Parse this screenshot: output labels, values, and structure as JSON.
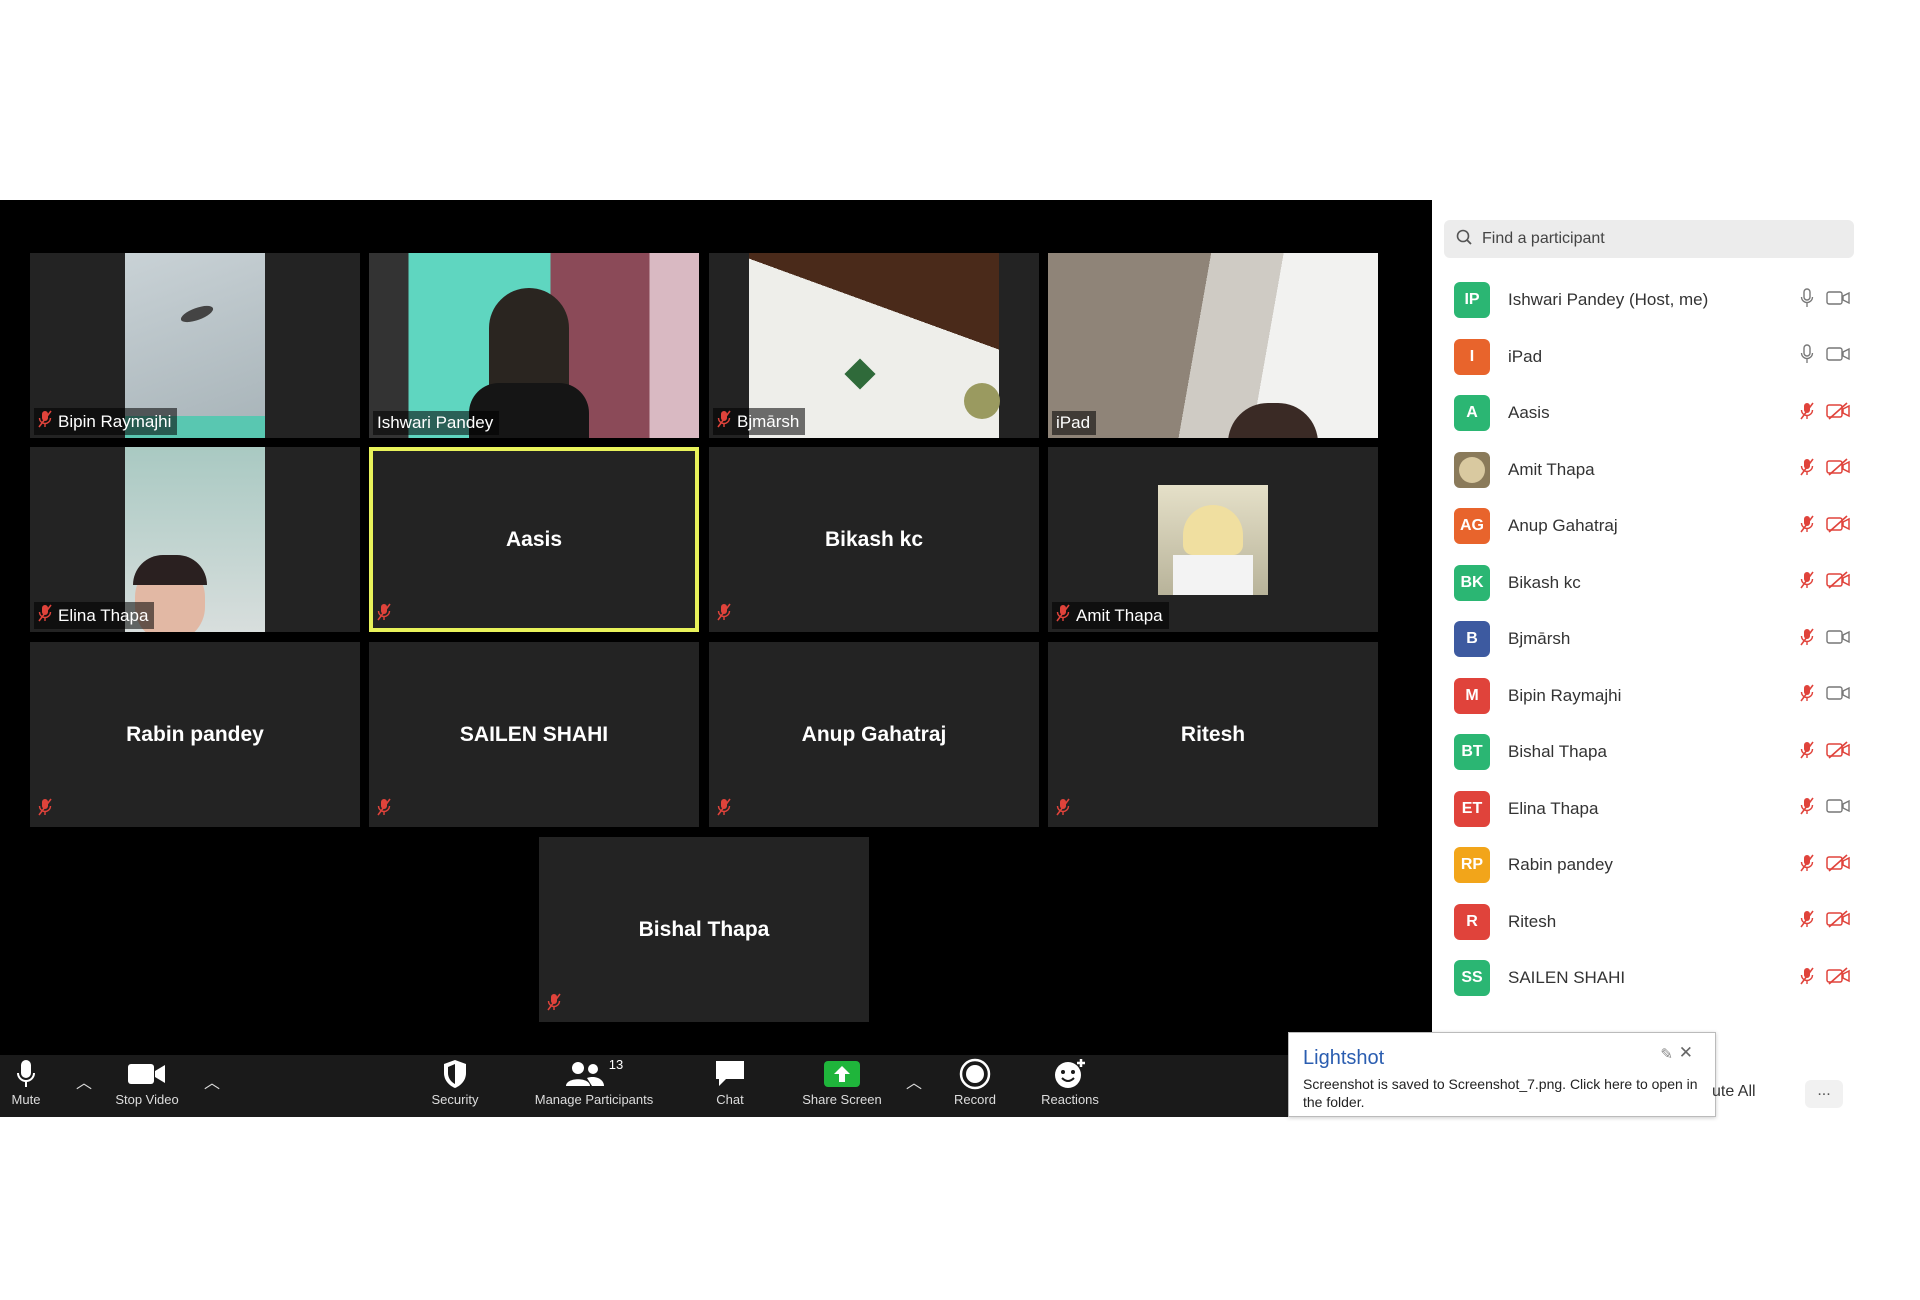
{
  "colors": {
    "active_border": "#e8f25a",
    "muted_red": "#e0433b",
    "share_green": "#1fb53b"
  },
  "video_grid": [
    {
      "name": "Bipin Raymajhi",
      "has_video": true,
      "muted": true
    },
    {
      "name": "Ishwari Pandey",
      "has_video": true,
      "muted": false
    },
    {
      "name": "Bjmārsh",
      "has_video": true,
      "muted": true
    },
    {
      "name": "iPad",
      "has_video": true,
      "muted": false
    },
    {
      "name": "Elina Thapa",
      "has_video": true,
      "muted": true
    },
    {
      "name": "Aasis",
      "has_video": false,
      "muted": true,
      "active_speaker": true
    },
    {
      "name": "Bikash kc",
      "has_video": false,
      "muted": true
    },
    {
      "name": "Amit Thapa",
      "has_video": false,
      "has_profile_picture": true,
      "muted": true
    },
    {
      "name": "Rabin pandey",
      "has_video": false,
      "muted": true
    },
    {
      "name": "SAILEN SHAHI",
      "has_video": false,
      "muted": true
    },
    {
      "name": "Anup Gahatraj",
      "has_video": false,
      "muted": true
    },
    {
      "name": "Ritesh",
      "has_video": false,
      "muted": true
    },
    {
      "name": "Bishal Thapa",
      "has_video": false,
      "muted": true
    }
  ],
  "toolbar": {
    "mute": "Mute",
    "stop_video": "Stop Video",
    "security": "Security",
    "manage_participants": "Manage Participants",
    "participant_count": "13",
    "chat": "Chat",
    "share_screen": "Share Screen",
    "record": "Record",
    "reactions": "Reactions"
  },
  "participants_panel": {
    "search_placeholder": "Find a participant",
    "participants": [
      {
        "initials": "IP",
        "name": "Ishwari Pandey (Host, me)",
        "avatar_color": "#2bb673",
        "mic": "on",
        "video": "on"
      },
      {
        "initials": "I",
        "name": "iPad",
        "avatar_color": "#e8642c",
        "mic": "on",
        "video": "on"
      },
      {
        "initials": "A",
        "name": "Aasis",
        "avatar_color": "#2bb673",
        "mic": "muted",
        "video": "off"
      },
      {
        "initials": "",
        "name": "Amit Thapa",
        "avatar_color": "#8a7a5a",
        "mic": "muted",
        "video": "off"
      },
      {
        "initials": "AG",
        "name": "Anup Gahatraj",
        "avatar_color": "#e8642c",
        "mic": "muted",
        "video": "off"
      },
      {
        "initials": "BK",
        "name": "Bikash kc",
        "avatar_color": "#2bb673",
        "mic": "muted",
        "video": "off"
      },
      {
        "initials": "B",
        "name": "Bjmārsh",
        "avatar_color": "#3d5aa0",
        "mic": "muted",
        "video": "on"
      },
      {
        "initials": "M",
        "name": "Bipin Raymajhi",
        "avatar_color": "#e0433b",
        "mic": "muted",
        "video": "on"
      },
      {
        "initials": "BT",
        "name": "Bishal Thapa",
        "avatar_color": "#2bb673",
        "mic": "muted",
        "video": "off"
      },
      {
        "initials": "ET",
        "name": "Elina Thapa",
        "avatar_color": "#e0433b",
        "mic": "muted",
        "video": "on"
      },
      {
        "initials": "RP",
        "name": "Rabin pandey",
        "avatar_color": "#f2a51a",
        "mic": "muted",
        "video": "off"
      },
      {
        "initials": "R",
        "name": "Ritesh",
        "avatar_color": "#e0433b",
        "mic": "muted",
        "video": "off"
      },
      {
        "initials": "SS",
        "name": "SAILEN SHAHI",
        "avatar_color": "#2bb673",
        "mic": "muted",
        "video": "off"
      }
    ],
    "mute_all_label": "ute All",
    "more_label": "..."
  },
  "lightshot": {
    "title": "Lightshot",
    "message": "Screenshot is saved to Screenshot_7.png. Click here to open in the folder."
  }
}
